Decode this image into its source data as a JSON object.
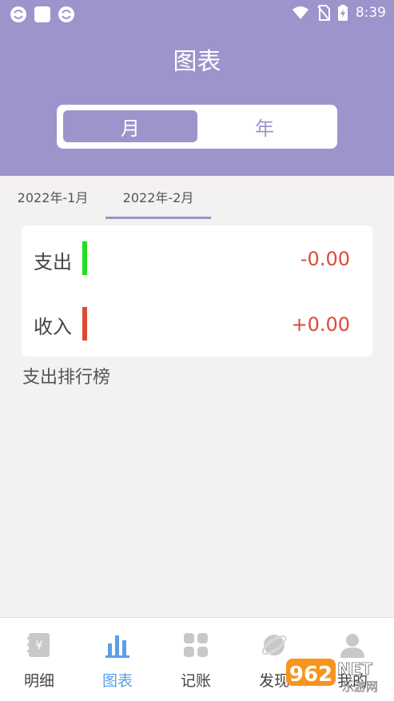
{
  "status_bar": {
    "time": "8:39"
  },
  "header": {
    "title": "图表"
  },
  "period_toggle": {
    "month": "月",
    "year": "年"
  },
  "month_tabs": [
    {
      "label": "2022年-1月"
    },
    {
      "label": "2022年-2月"
    }
  ],
  "summary": {
    "expense": {
      "label": "支出",
      "amount": "-0.00",
      "bar_color": "#1ee01e"
    },
    "income": {
      "label": "收入",
      "amount": "+0.00",
      "bar_color": "#e04a35"
    }
  },
  "ranking": {
    "title": "支出排行榜"
  },
  "bottom_nav": [
    {
      "label": "明细",
      "icon": "ledger-icon"
    },
    {
      "label": "图表",
      "icon": "bar-chart-icon"
    },
    {
      "label": "记账",
      "icon": "grid-icon"
    },
    {
      "label": "发现",
      "icon": "planet-icon"
    },
    {
      "label": "我的",
      "icon": "person-icon"
    }
  ],
  "watermark": {
    "brand": "962",
    "suffix": "NET",
    "text": "乐游网"
  },
  "colors": {
    "accent": "#9b95cb",
    "active_nav": "#5aa0e8",
    "amount": "#dd4a3a"
  }
}
